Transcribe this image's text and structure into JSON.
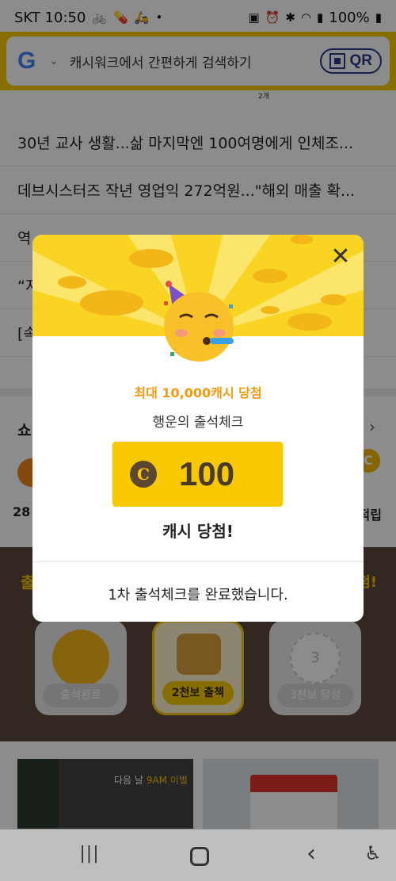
{
  "status_bar": {
    "carrier_time": "SKT 10:50",
    "battery": "100%",
    "left_icons": [
      "bike-icon",
      "pill-icon",
      "delivery-icon",
      "dot-icon"
    ],
    "right_icons": [
      "battery-saver-icon",
      "alarm-icon",
      "bluetooth-icon",
      "wifi-icon",
      "signal-icon",
      "battery-icon"
    ]
  },
  "search": {
    "placeholder": "캐시워크에서 간편하게 검색하기",
    "qr_label": "QR"
  },
  "news": {
    "items": [
      "30년 교사 생활...삶 마지막엔 100여명에게 인체조...",
      "데브시스터즈 작년 영업익 272억원...\"해외 매출 확...",
      "역",
      "“지",
      "[속"
    ],
    "thumb_caption": "2개"
  },
  "shop": {
    "title": "쇼",
    "left_value": "28",
    "right_value": "적립",
    "right_badge": "C"
  },
  "checkin": {
    "title": "출",
    "right_text": "첨!",
    "cards": [
      {
        "label": "출석완료"
      },
      {
        "label": "2천보 출첵"
      },
      {
        "label": "3천보 달성",
        "number": "3"
      }
    ]
  },
  "banner": {
    "caption_prefix": "다음 날",
    "caption_highlight": "9AM 이벌"
  },
  "popup": {
    "subtitle": "최대 10,000캐시 당첨",
    "title": "행운의 출석체크",
    "coin_symbol": "C",
    "amount": "100",
    "win_text": "캐시 당첨!",
    "footer": "1차 출석체크를 완료했습니다.",
    "close_symbol": "✕"
  },
  "nav": {
    "recent_symbol": "|||",
    "back_symbol": "‹",
    "accessibility_symbol": "♿"
  },
  "colors": {
    "brand_yellow": "#f6c800",
    "popup_accent": "#f29a12",
    "cash_box": "#f8c900",
    "coin_brown": "#5b4632"
  }
}
